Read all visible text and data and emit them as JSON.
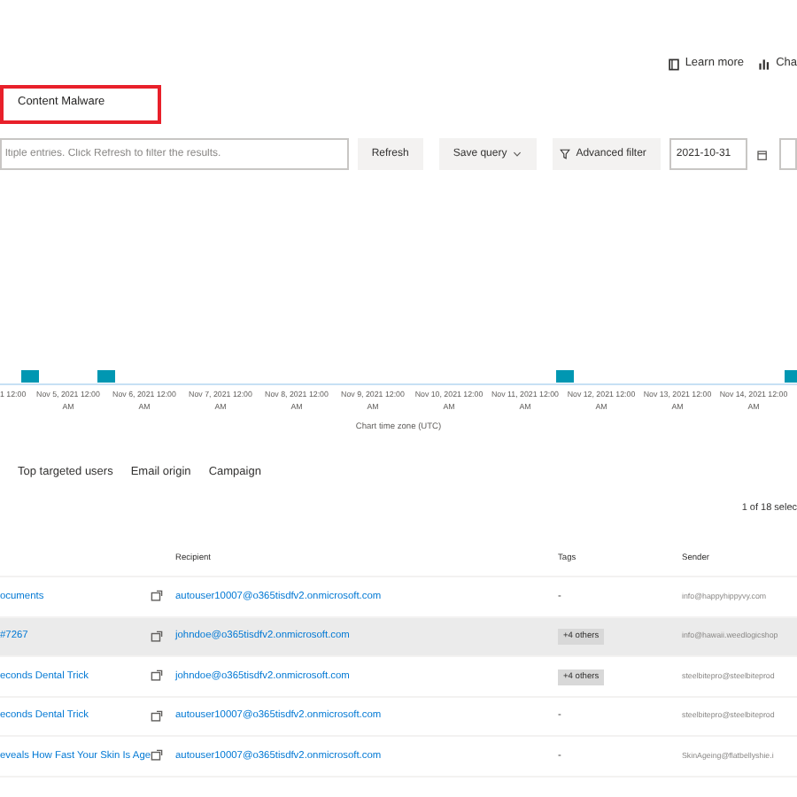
{
  "header_links": [
    {
      "label": "Learn more"
    },
    {
      "label": "Cha"
    }
  ],
  "tab": {
    "label": "Content Malware",
    "highlighted": true
  },
  "toolbar": {
    "search": {
      "placeholder": "ltiple entries. Click Refresh to filter the results."
    },
    "refresh": "Refresh",
    "save_query": "Save query",
    "advanced_filter": "Advanced filter",
    "date": "2021-10-31"
  },
  "chart": {
    "x_axis_labels": [
      [
        "1 12:00"
      ],
      [
        "Nov 5, 2021 12:00",
        "AM"
      ],
      [
        "Nov 6, 2021 12:00",
        "AM"
      ],
      [
        "Nov 7, 2021 12:00",
        "AM"
      ],
      [
        "Nov 8, 2021 12:00",
        "AM"
      ],
      [
        "Nov 9, 2021 12:00",
        "AM"
      ],
      [
        "Nov 10, 2021 12:00",
        "AM"
      ],
      [
        "Nov 11, 2021 12:00",
        "AM"
      ],
      [
        "Nov 12, 2021 12:00",
        "AM"
      ],
      [
        "Nov 13, 2021 12:00",
        "AM"
      ],
      [
        "Nov 14, 2021 12:00",
        "AM"
      ]
    ],
    "axis_title": "Chart time zone (UTC)"
  },
  "view_tabs": [
    "Top targeted users",
    "Email origin",
    "Campaign"
  ],
  "selection_count": "1 of 18 selec",
  "table": {
    "columns": [
      "Recipient",
      "Tags",
      "Sender"
    ],
    "rows": [
      {
        "subject": "ocuments",
        "recipient": "autouser10007@o365tisdfv2.onmicrosoft.com",
        "tags": "-",
        "sender": "info@happyhippyvy.com",
        "selected": false
      },
      {
        "subject": "#7267",
        "recipient": "johndoe@o365tisdfv2.onmicrosoft.com",
        "tags": "+4 others",
        "sender": "info@hawaii.weedlogicshop",
        "selected": true
      },
      {
        "subject": "econds Dental Trick",
        "recipient": "johndoe@o365tisdfv2.onmicrosoft.com",
        "tags": "+4 others",
        "sender": "steelbitepro@steelbiteprod",
        "selected": false
      },
      {
        "subject": "econds Dental Trick",
        "recipient": "autouser10007@o365tisdfv2.onmicrosoft.com",
        "tags": "-",
        "sender": "steelbitepro@steelbiteprod",
        "selected": false
      },
      {
        "subject": "eveals How Fast Your Skin Is Age",
        "recipient": "autouser10007@o365tisdfv2.onmicrosoft.com",
        "tags": "-",
        "sender": "SkinAgeing@flatbellyshie.i",
        "selected": false
      }
    ]
  }
}
